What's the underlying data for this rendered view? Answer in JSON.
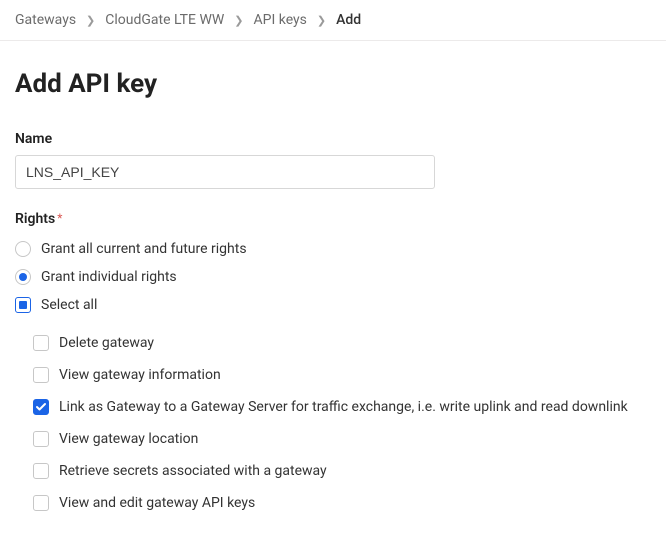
{
  "breadcrumb": {
    "items": [
      {
        "label": "Gateways"
      },
      {
        "label": "CloudGate LTE WW"
      },
      {
        "label": "API keys"
      },
      {
        "label": "Add"
      }
    ]
  },
  "page": {
    "title": "Add API key"
  },
  "name_field": {
    "label": "Name",
    "value": "LNS_API_KEY"
  },
  "rights": {
    "label": "Rights",
    "options": {
      "grant_all": "Grant all current and future rights",
      "grant_individual": "Grant individual rights"
    },
    "selected": "grant_individual",
    "select_all_label": "Select all",
    "select_all_state": "indeterminate",
    "items": [
      {
        "label": "Delete gateway",
        "checked": false
      },
      {
        "label": "View gateway information",
        "checked": false
      },
      {
        "label": "Link as Gateway to a Gateway Server for traffic exchange, i.e. write uplink and read downlink",
        "checked": true
      },
      {
        "label": "View gateway location",
        "checked": false
      },
      {
        "label": "Retrieve secrets associated with a gateway",
        "checked": false
      },
      {
        "label": "View and edit gateway API keys",
        "checked": false
      }
    ]
  }
}
